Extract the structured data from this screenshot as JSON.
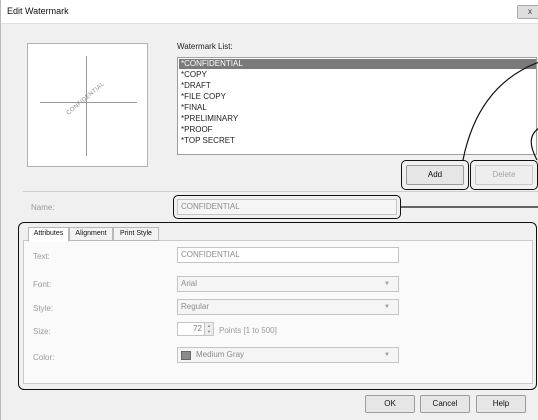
{
  "window": {
    "title": "Edit Watermark",
    "close_label": "x"
  },
  "preview": {
    "watermark_text": "CONFIDENTIAL"
  },
  "watermark_list": {
    "label": "Watermark List:",
    "items": [
      {
        "label": "*CONFIDENTIAL",
        "selected": true
      },
      {
        "label": "*COPY",
        "selected": false
      },
      {
        "label": "*DRAFT",
        "selected": false
      },
      {
        "label": "*FILE COPY",
        "selected": false
      },
      {
        "label": "*FINAL",
        "selected": false
      },
      {
        "label": "*PRELIMINARY",
        "selected": false
      },
      {
        "label": "*PROOF",
        "selected": false
      },
      {
        "label": "*TOP SECRET",
        "selected": false
      }
    ]
  },
  "buttons": {
    "add": "Add",
    "delete": "Delete",
    "ok": "OK",
    "cancel": "Cancel",
    "help": "Help"
  },
  "name_field": {
    "label": "Name:",
    "value": "CONFIDENTIAL"
  },
  "tabs": [
    {
      "label": "Attributes",
      "active": true
    },
    {
      "label": "Alignment",
      "active": false
    },
    {
      "label": "Print Style",
      "active": false
    }
  ],
  "attributes": {
    "text": {
      "label": "Text:",
      "value": "CONFIDENTIAL"
    },
    "font": {
      "label": "Font:",
      "value": "Arial"
    },
    "style": {
      "label": "Style:",
      "value": "Regular"
    },
    "size": {
      "label": "Size:",
      "value": "72",
      "range_note": "Points [1 to 500]"
    },
    "color": {
      "label": "Color:",
      "value": "Medium Gray",
      "swatch": "#8a8a8a"
    }
  },
  "colors": {
    "selection": "#7a7a7a",
    "callout": "#111111"
  }
}
